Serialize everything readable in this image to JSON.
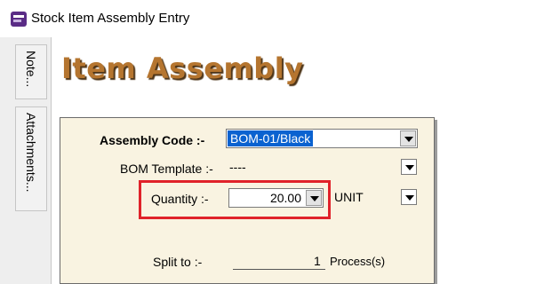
{
  "window": {
    "title": "Stock Item Assembly Entry",
    "icon": "app-logo-icon"
  },
  "side_tabs": [
    {
      "label": "Note..."
    },
    {
      "label": "Attachments..."
    }
  ],
  "heading": "Item Assembly",
  "form": {
    "assembly_code": {
      "label": "Assembly Code :-",
      "value": "BOM-01/Black"
    },
    "bom_template": {
      "label": "BOM Template :-",
      "value": "----"
    },
    "quantity": {
      "label": "Quantity :-",
      "value": "20.00",
      "uom": "UNIT"
    },
    "split": {
      "label": "Split to :-",
      "value": "1",
      "suffix": "Process(s)"
    }
  },
  "colors": {
    "heading": "#b5752f",
    "panel_bg": "#f9f3e1",
    "selection": "#0a62d0",
    "highlight_box": "#e0222a"
  }
}
